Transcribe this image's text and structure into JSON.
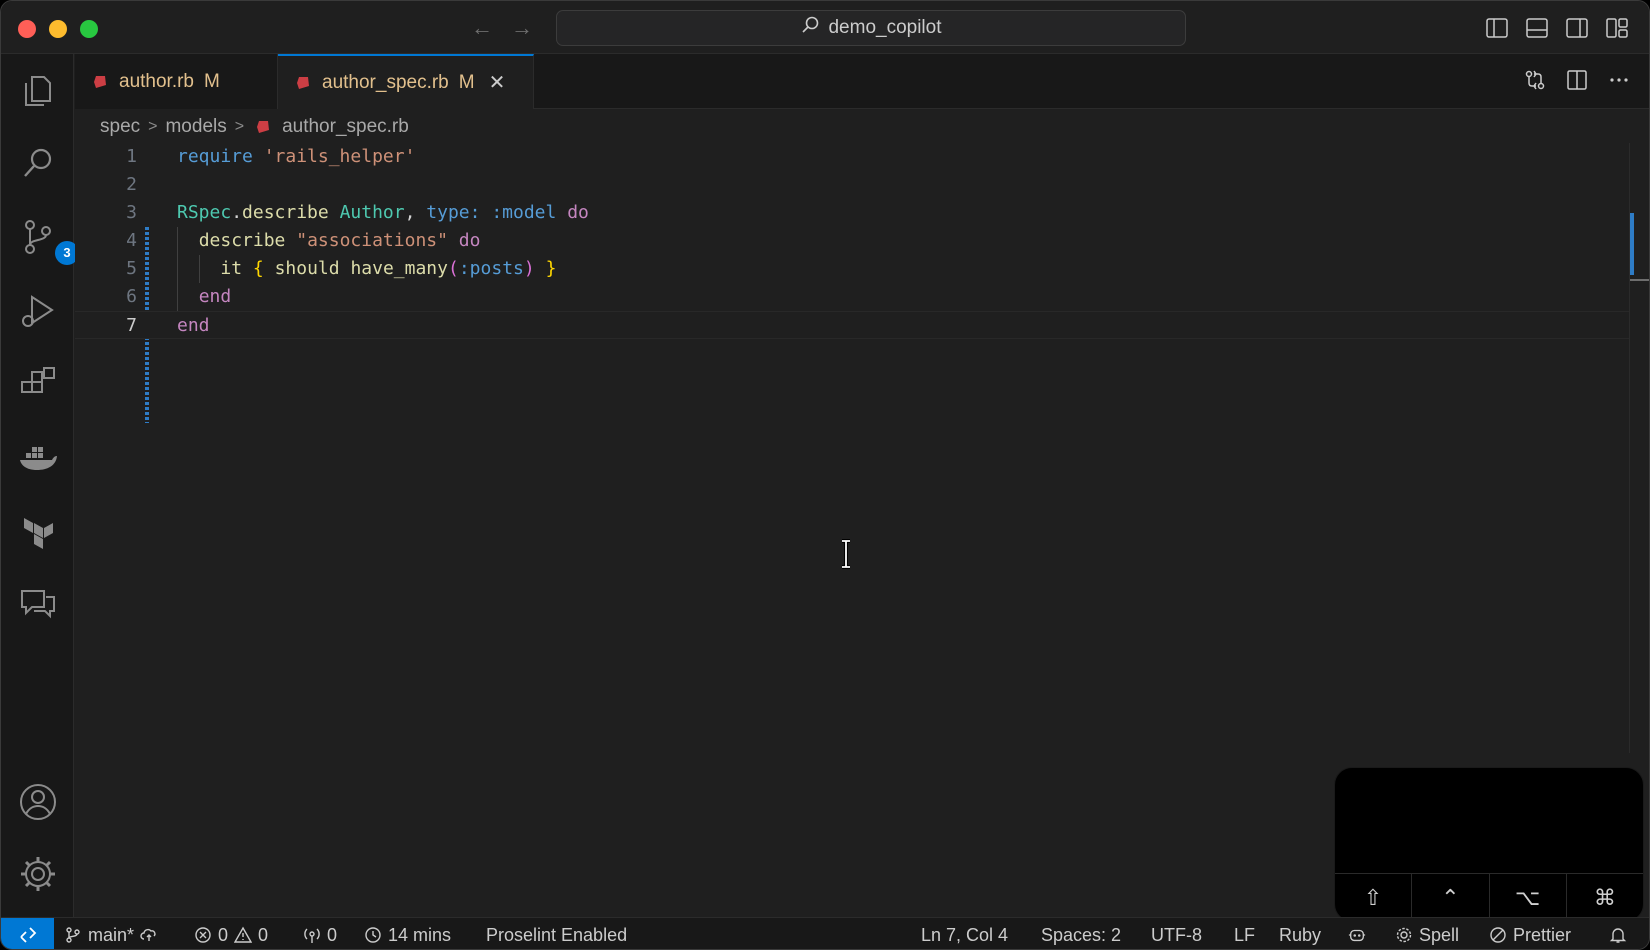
{
  "titlebar": {
    "search_text": "demo_copilot"
  },
  "activity": {
    "scm_badge": "3"
  },
  "tabs": [
    {
      "label": "author.rb",
      "status": "M",
      "active": false
    },
    {
      "label": "author_spec.rb",
      "status": "M",
      "active": true,
      "close": "✕"
    }
  ],
  "breadcrumb": {
    "items": [
      "spec",
      "models",
      "author_spec.rb"
    ]
  },
  "editor": {
    "language": "Ruby",
    "current_line": 7,
    "lines": [
      {
        "num": "1",
        "text": "require 'rails_helper'"
      },
      {
        "num": "2",
        "text": ""
      },
      {
        "num": "3",
        "text": "RSpec.describe Author, type: :model do"
      },
      {
        "num": "4",
        "text": "  describe \"associations\" do"
      },
      {
        "num": "5",
        "text": "    it { should have_many(:posts) }"
      },
      {
        "num": "6",
        "text": "  end"
      },
      {
        "num": "7",
        "text": "end"
      }
    ]
  },
  "keyboard_overlay": {
    "keys": [
      "⇧",
      "⌃",
      "⌥",
      "⌘"
    ]
  },
  "statusbar": {
    "branch": "main*",
    "errors": "0",
    "warnings": "0",
    "ports": "0",
    "timer": "14 mins",
    "proselint": "Proselint Enabled",
    "position": "Ln 7, Col 4",
    "spaces": "Spaces: 2",
    "encoding": "UTF-8",
    "eol": "LF",
    "language": "Ruby",
    "spell": "Spell",
    "prettier": "Prettier"
  },
  "colors": {
    "accent": "#0078d4",
    "modified": "#e2c08d",
    "ruby_icon": "#cc3e44",
    "editor_bg": "#1f1f1f"
  }
}
